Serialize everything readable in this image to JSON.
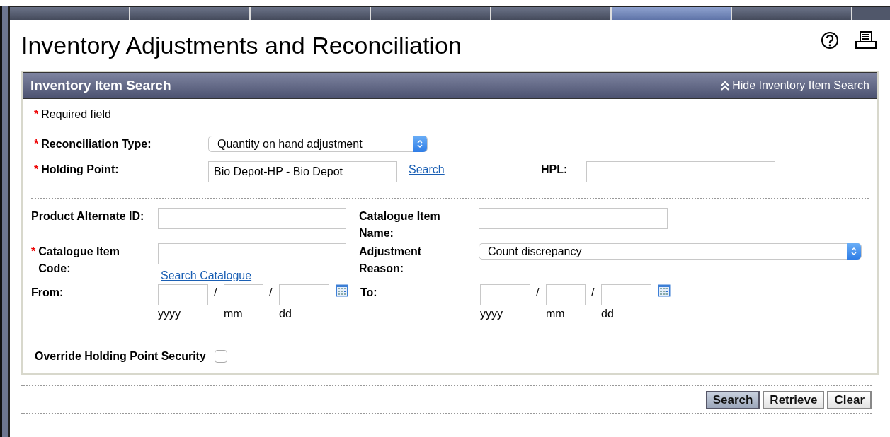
{
  "nav_tabs": [
    {
      "selected": false
    },
    {
      "selected": false
    },
    {
      "selected": false
    },
    {
      "selected": false
    },
    {
      "selected": false
    },
    {
      "selected": true
    },
    {
      "selected": false
    }
  ],
  "title": "Inventory Adjustments and Reconciliation",
  "panel": {
    "title": "Inventory Item Search",
    "toggle": "Hide Inventory Item Search"
  },
  "required_note": {
    "mark": "*",
    "text": "Required field"
  },
  "reconciliation_type": {
    "mark": "*",
    "label": "Reconciliation Type:",
    "value": "Quantity on hand adjustment"
  },
  "holding_point": {
    "mark": "*",
    "label": "Holding Point:",
    "value": "Bio Depot-HP - Bio Depot",
    "link": "Search"
  },
  "hpl": {
    "label": "HPL:"
  },
  "product_alternate_id": {
    "label": "Product Alternate ID:"
  },
  "catalogue_item_name": {
    "label": "Catalogue Item Name:"
  },
  "catalogue_item_code": {
    "mark": "*",
    "label": "Catalogue Item Code:",
    "link": "Search Catalogue"
  },
  "adjustment_reason": {
    "label": "Adjustment Reason:",
    "value": "Count discrepancy"
  },
  "from": {
    "label": "From:",
    "separators": [
      "/",
      "/"
    ],
    "parts": [
      "yyyy",
      "mm",
      "dd"
    ]
  },
  "to": {
    "label": "To:",
    "separators": [
      "/",
      "/"
    ],
    "parts": [
      "yyyy",
      "mm",
      "dd"
    ]
  },
  "override": {
    "label": "Override Holding Point Security",
    "checked": false
  },
  "buttons": [
    {
      "label": "Search",
      "kind": "primary"
    },
    {
      "label": "Retrieve",
      "kind": "secondary"
    },
    {
      "label": "Clear",
      "kind": "secondary"
    }
  ]
}
